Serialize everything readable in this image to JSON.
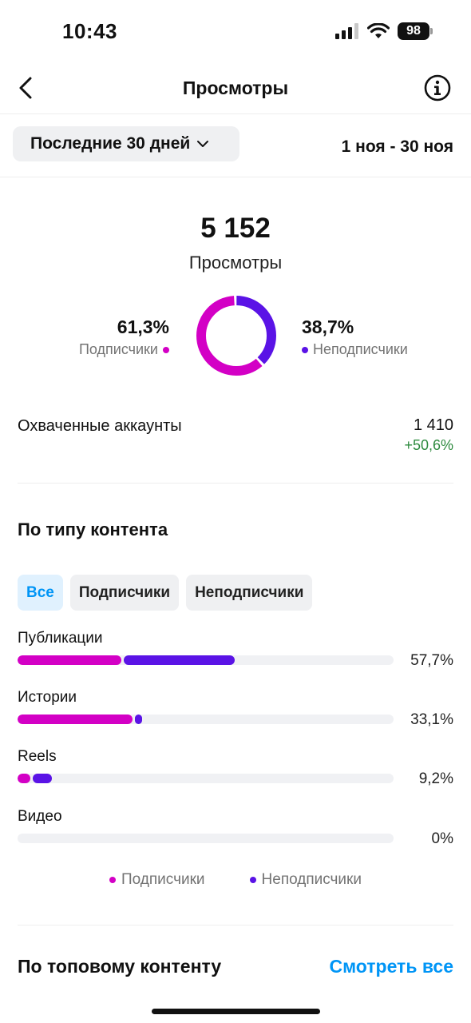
{
  "status_bar": {
    "time": "10:43",
    "battery": "98"
  },
  "header": {
    "title": "Просмотры",
    "back_icon": "chevron-left-icon",
    "info_icon": "info-icon"
  },
  "period": {
    "selector_label": "Последние 30 дней",
    "date_range": "1 ноя - 30 ноя"
  },
  "summary": {
    "total_value": "5 152",
    "total_label": "Просмотры",
    "followers_pct_text": "61,3%",
    "followers_label": "Подписчики",
    "non_followers_pct_text": "38,7%",
    "non_followers_label": "Неподписчики",
    "followers_fraction": 0.613,
    "non_followers_fraction": 0.387
  },
  "reached": {
    "label": "Охваченные аккаунты",
    "value": "1 410",
    "change": "+50,6%"
  },
  "content_type": {
    "title": "По типу контента",
    "filters": [
      {
        "label": "Все",
        "active": true
      },
      {
        "label": "Подписчики",
        "active": false
      },
      {
        "label": "Неподписчики",
        "active": false
      }
    ],
    "rows": [
      {
        "label": "Публикации",
        "pct_text": "57,7%",
        "followers_fraction": 0.275,
        "non_followers_fraction": 0.302
      },
      {
        "label": "Истории",
        "pct_text": "33,1%",
        "followers_fraction": 0.305,
        "non_followers_fraction": 0.026
      },
      {
        "label": "Reels",
        "pct_text": "9,2%",
        "followers_fraction": 0.034,
        "non_followers_fraction": 0.058
      },
      {
        "label": "Видео",
        "pct_text": "0%",
        "followers_fraction": 0,
        "non_followers_fraction": 0
      }
    ],
    "legend": {
      "followers": "Подписчики",
      "non_followers": "Неподписчики"
    }
  },
  "top_content": {
    "title": "По топовому контенту",
    "see_all": "Смотреть все"
  },
  "colors": {
    "followers": "#d300c5",
    "non_followers": "#5a13e6",
    "accent": "#0095f6",
    "positive": "#2d8a3e"
  }
}
